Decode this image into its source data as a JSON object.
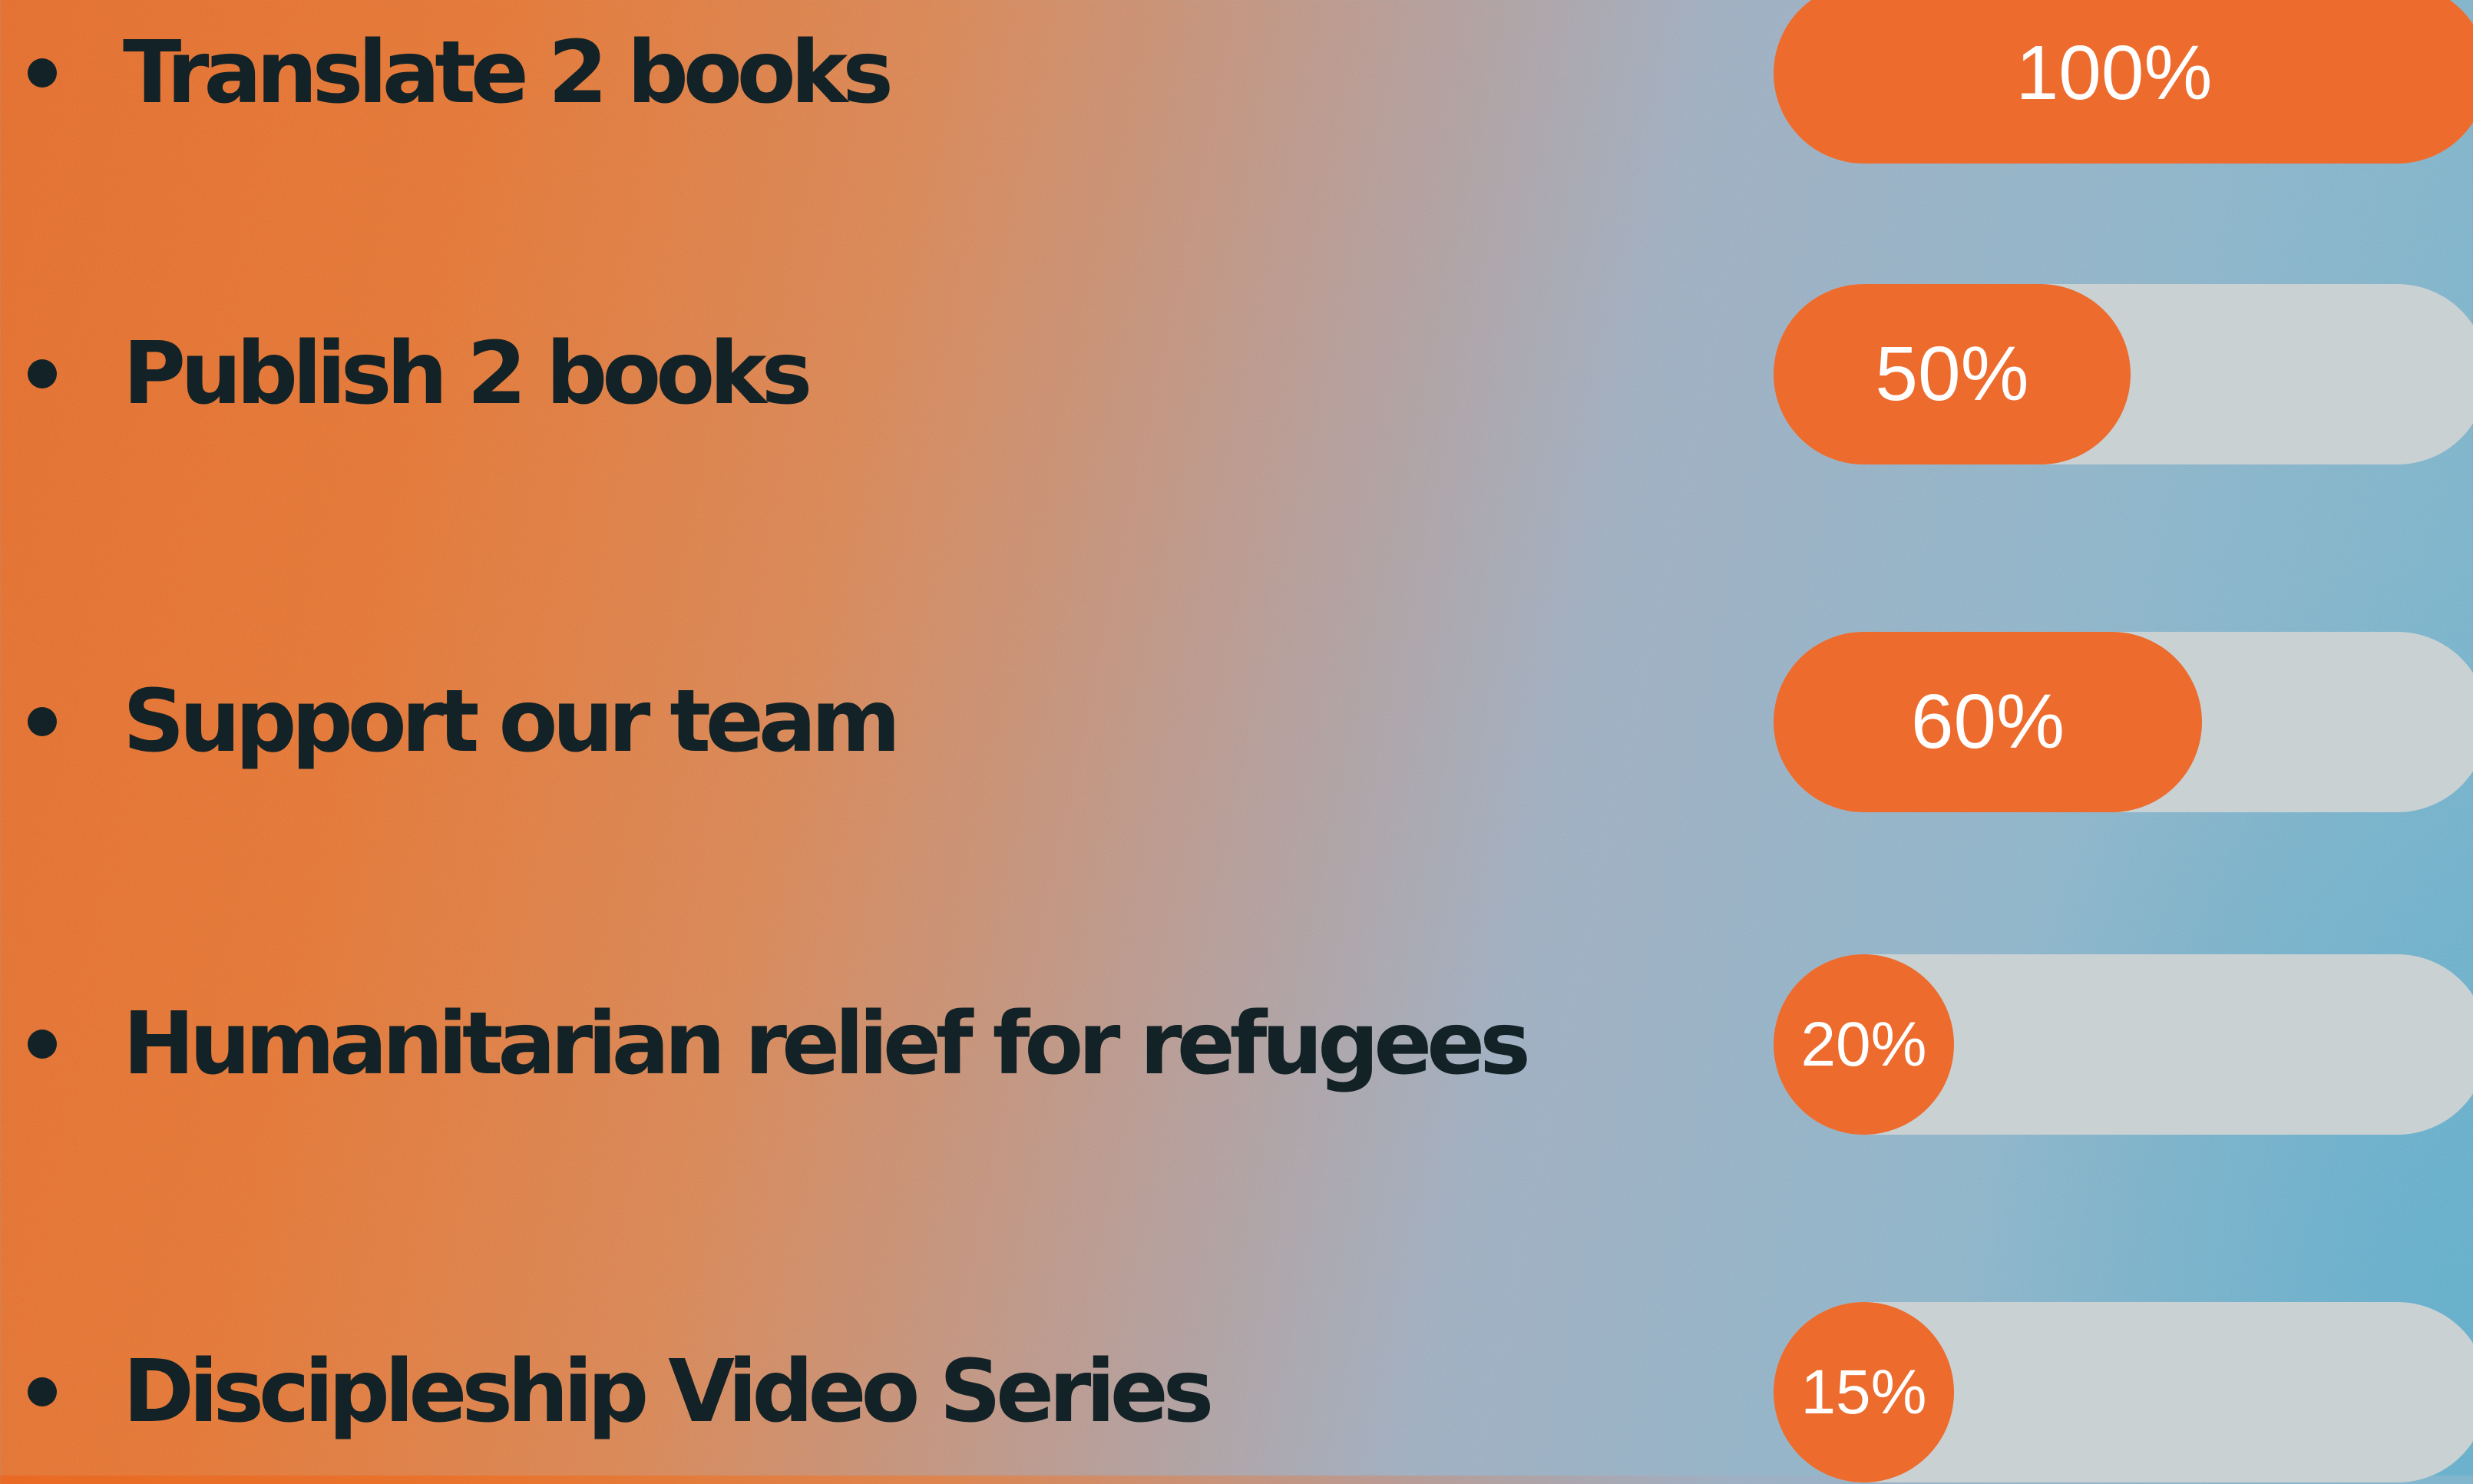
{
  "colors": {
    "accent_orange": "#ec6b2d",
    "track_gray": "#c9d1d3",
    "text_dark": "#132226",
    "bg_left": "#e96a24",
    "bg_right": "#70b6d0"
  },
  "goals": [
    {
      "label": "Translate  2 books",
      "percent_text": "100%",
      "progress": 1.0
    },
    {
      "label": "Publish 2 books",
      "percent_text": "50%",
      "progress": 0.5
    },
    {
      "label": "Support our team",
      "percent_text": "60%",
      "progress": 0.6
    },
    {
      "label": "Humanitarian relief for refugees",
      "percent_text": "20%",
      "progress": 0.2
    },
    {
      "label": "Discipleship Video Series",
      "percent_text": "15%",
      "progress": 0.15
    }
  ]
}
